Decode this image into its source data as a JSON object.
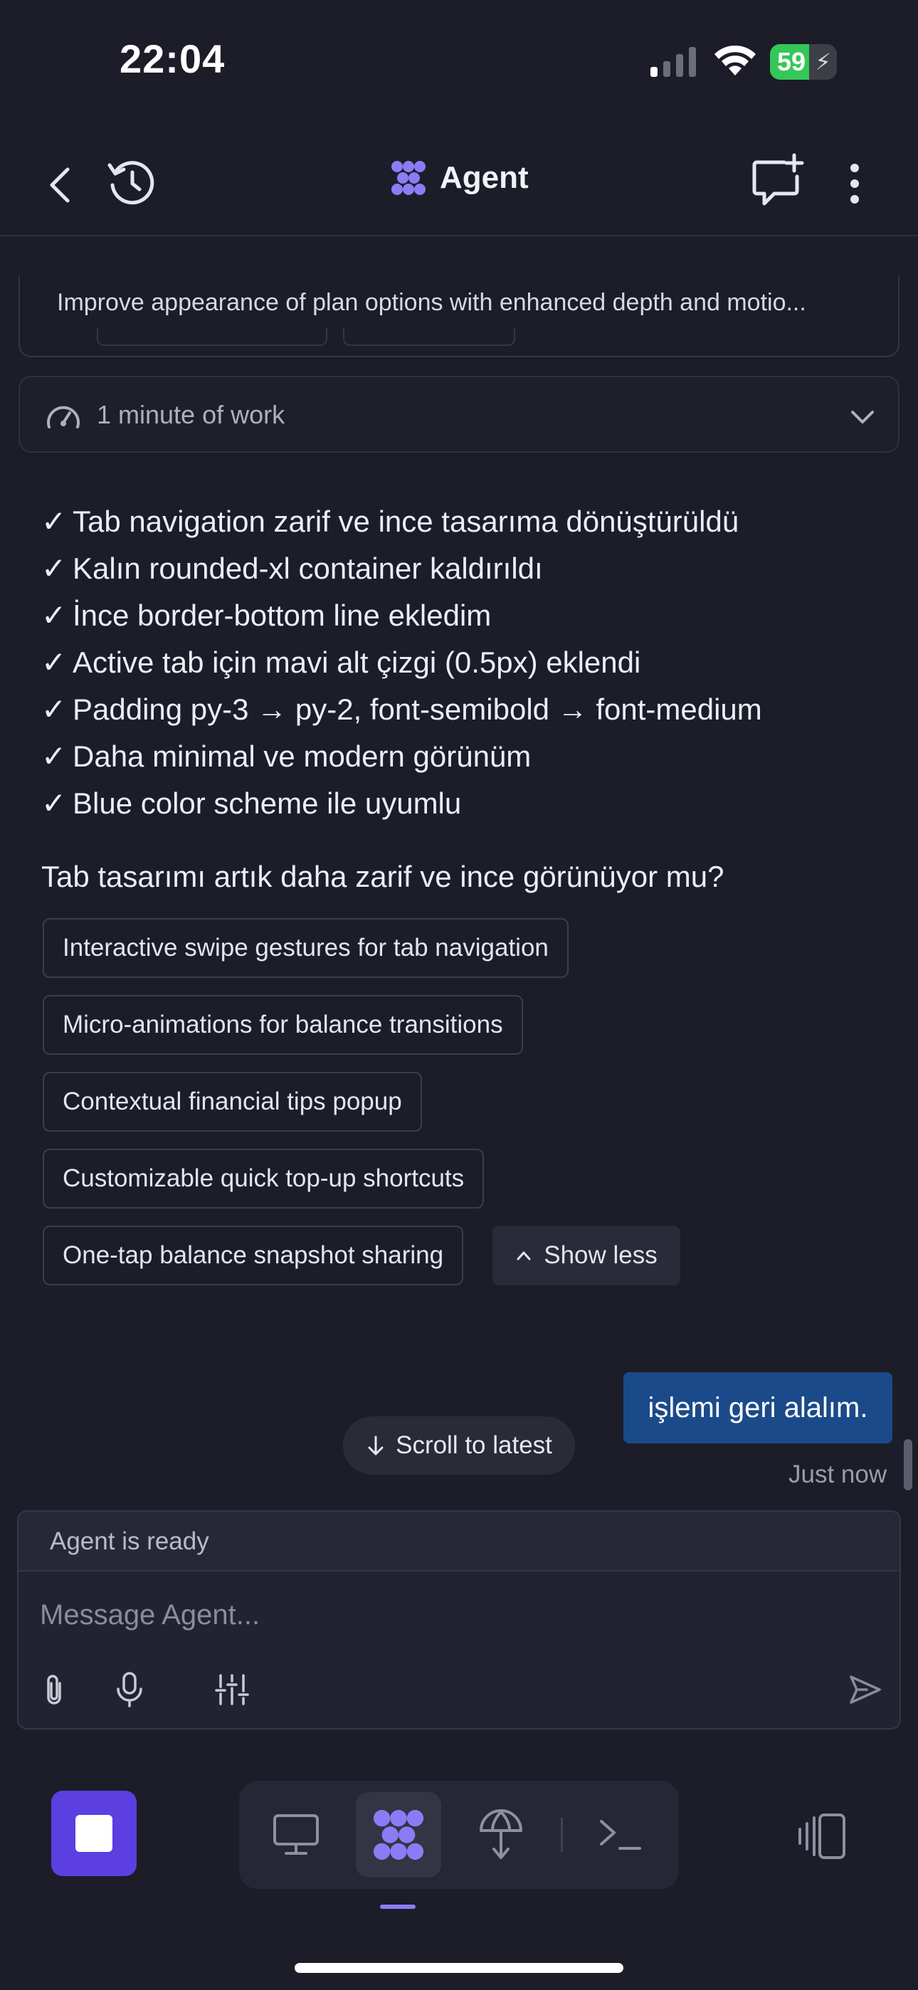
{
  "status_bar": {
    "time": "22:04",
    "battery_percent": "59",
    "battery_level": 0.59,
    "signal_bars_active": 1
  },
  "header": {
    "title": "Agent",
    "back_icon": "chevron-left-icon",
    "history_icon": "history-icon",
    "new_chat_icon": "new-chat-icon",
    "more_icon": "more-vertical-icon",
    "accent": "#8b7cf5"
  },
  "plan": {
    "text": "Improve appearance of plan options with enhanced depth and motio..."
  },
  "work": {
    "label": "1 minute of work"
  },
  "message": {
    "checklist": [
      "✓",
      "Tab navigation zarif ve ince tasarıma dönüştürüldü",
      "Kalın rounded-xl container kaldırıldı",
      "İnce border-bottom line ekledim",
      "Active tab için mavi alt çizgi (0.5px) eklendi",
      "Padding py-3 → py-2, font-semibold → font-medium",
      "Daha minimal ve modern görünüm",
      "Blue color scheme ile uyumlu"
    ],
    "question": "Tab tasarımı artık daha zarif ve ince görünüyor mu?"
  },
  "suggestions": [
    "Interactive swipe gestures for tab navigation",
    "Micro-animations for balance transitions",
    "Contextual financial tips popup",
    "Customizable quick top-up shortcuts",
    "One-tap balance snapshot sharing"
  ],
  "show_less_label": "Show less",
  "user_message": {
    "text": "işlemi geri alalım.",
    "time": "Just now",
    "bubble_color": "#1b4a8a"
  },
  "scroll_latest_label": "Scroll to latest",
  "composer": {
    "status": "Agent is ready",
    "placeholder": "Message Agent..."
  },
  "dock": {
    "stop_color": "#5b3fe0",
    "items": [
      "desktop-icon",
      "agent-icon",
      "deploy-icon",
      "terminal-icon"
    ]
  }
}
